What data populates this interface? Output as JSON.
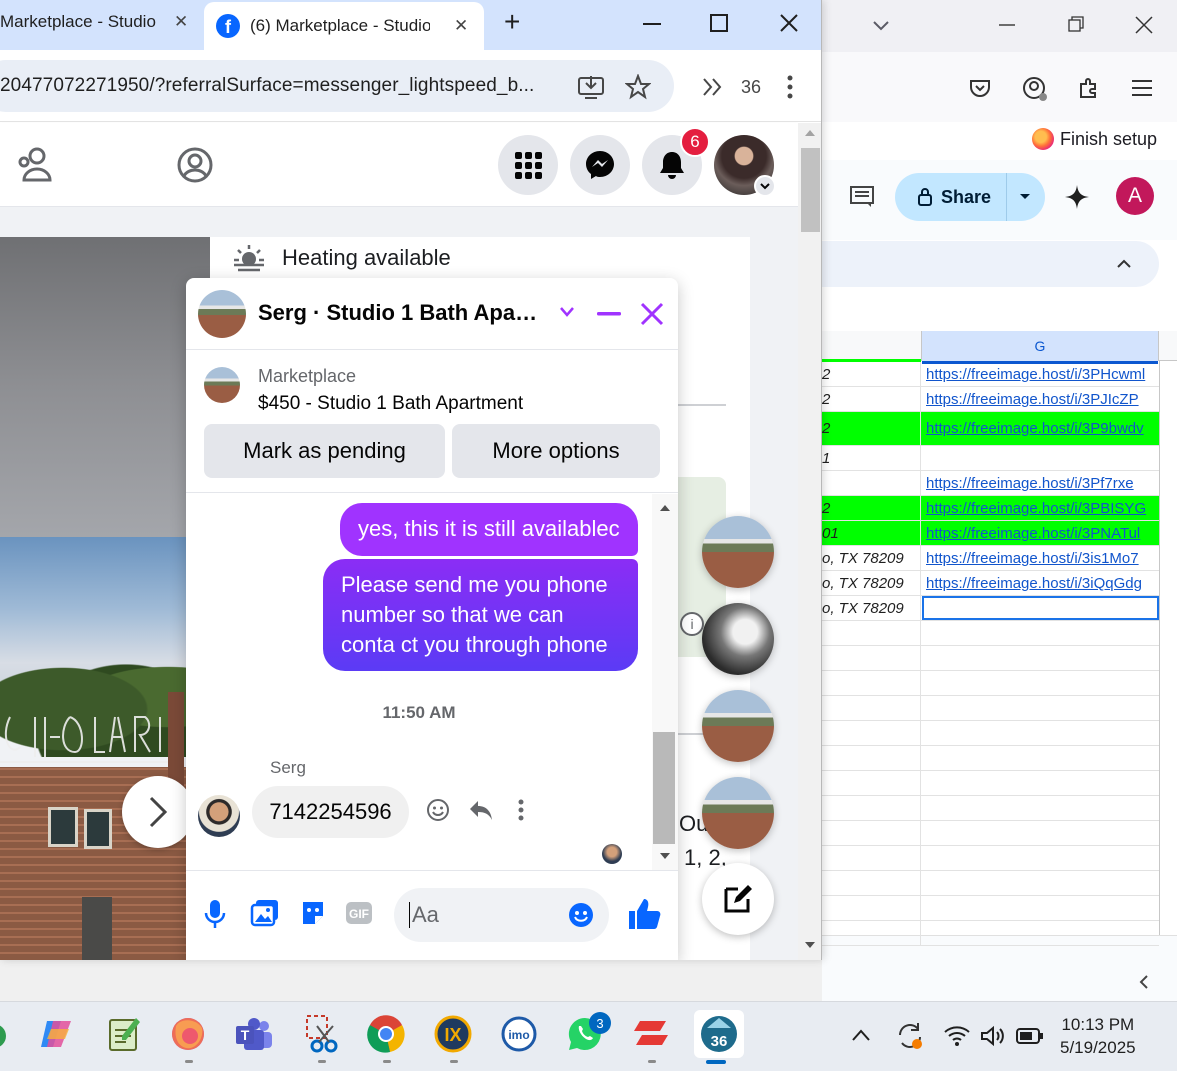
{
  "chrome": {
    "tabs": [
      {
        "title": "Marketplace - Studio"
      },
      {
        "title": "(6) Marketplace - Studio"
      }
    ],
    "address": "20477072271950/?referralSurface=messenger_lightspeed_b...",
    "toolbar_count": "36"
  },
  "facebook": {
    "notification_count": "6",
    "heating_label": "Heating available",
    "peek_text": [
      "Ou",
      "1, 2,"
    ]
  },
  "chat": {
    "title": "Serg · Studio 1 Bath Apart...",
    "marketplace_label": "Marketplace",
    "listing_title": "$450 - Studio 1 Bath Apartment",
    "mark_pending": "Mark as pending",
    "more_options": "More options",
    "messages_out": [
      "yes, this it is still availablec",
      "Please send me you phone number so that we can conta ct you through phone"
    ],
    "timestamp": "11:50 AM",
    "sender_name": "Serg",
    "message_in": "7142254596",
    "input_placeholder": "Aa"
  },
  "sheets_window": {
    "finish_setup": "Finish setup",
    "share_label": "Share",
    "avatar_letter": "A",
    "column_header": "G",
    "rows": [
      {
        "f": "2",
        "g": "https://freeimage.host/i/3PHcwml",
        "green": false
      },
      {
        "f": "2",
        "g": "https://freeimage.host/i/3PJIcZP",
        "green": false
      },
      {
        "f": "2",
        "g": "https://freeimage.host/i/3P9bwdv",
        "green": true
      },
      {
        "f": "1",
        "g": "",
        "green": false
      },
      {
        "f": "",
        "g": "https://freeimage.host/i/3Pf7rxe",
        "green": false
      },
      {
        "f": "2",
        "g": "https://freeimage.host/i/3PBISYG",
        "green": true
      },
      {
        "f": "01",
        "g": "https://freeimage.host/i/3PNATul",
        "green": true
      },
      {
        "f": "o, TX 78209",
        "g": "https://freeimage.host/i/3is1Mo7",
        "green": false
      },
      {
        "f": "o, TX 78209",
        "g": "https://freeimage.host/i/3iQqGdg",
        "green": false
      },
      {
        "f": "o, TX 78209",
        "g": "",
        "green": false
      }
    ]
  },
  "taskbar": {
    "apps": [
      "copilot-icon",
      "notepad-icon",
      "firefox-icon",
      "teams-icon",
      "snipping-tool-icon",
      "chrome-icon",
      "ix-icon",
      "imo-icon",
      "whatsapp-icon",
      "anydesk-icon",
      "app-36-icon"
    ],
    "whatsapp_badge": "3",
    "active_app_number": "36",
    "time": "10:13 PM",
    "date": "5/19/2025"
  },
  "colors": {
    "messenger_purple": "#a033ff",
    "facebook_blue": "#0866ff",
    "sheet_green": "#00ff00",
    "chrome_tabstrip": "#d3e3fd"
  }
}
